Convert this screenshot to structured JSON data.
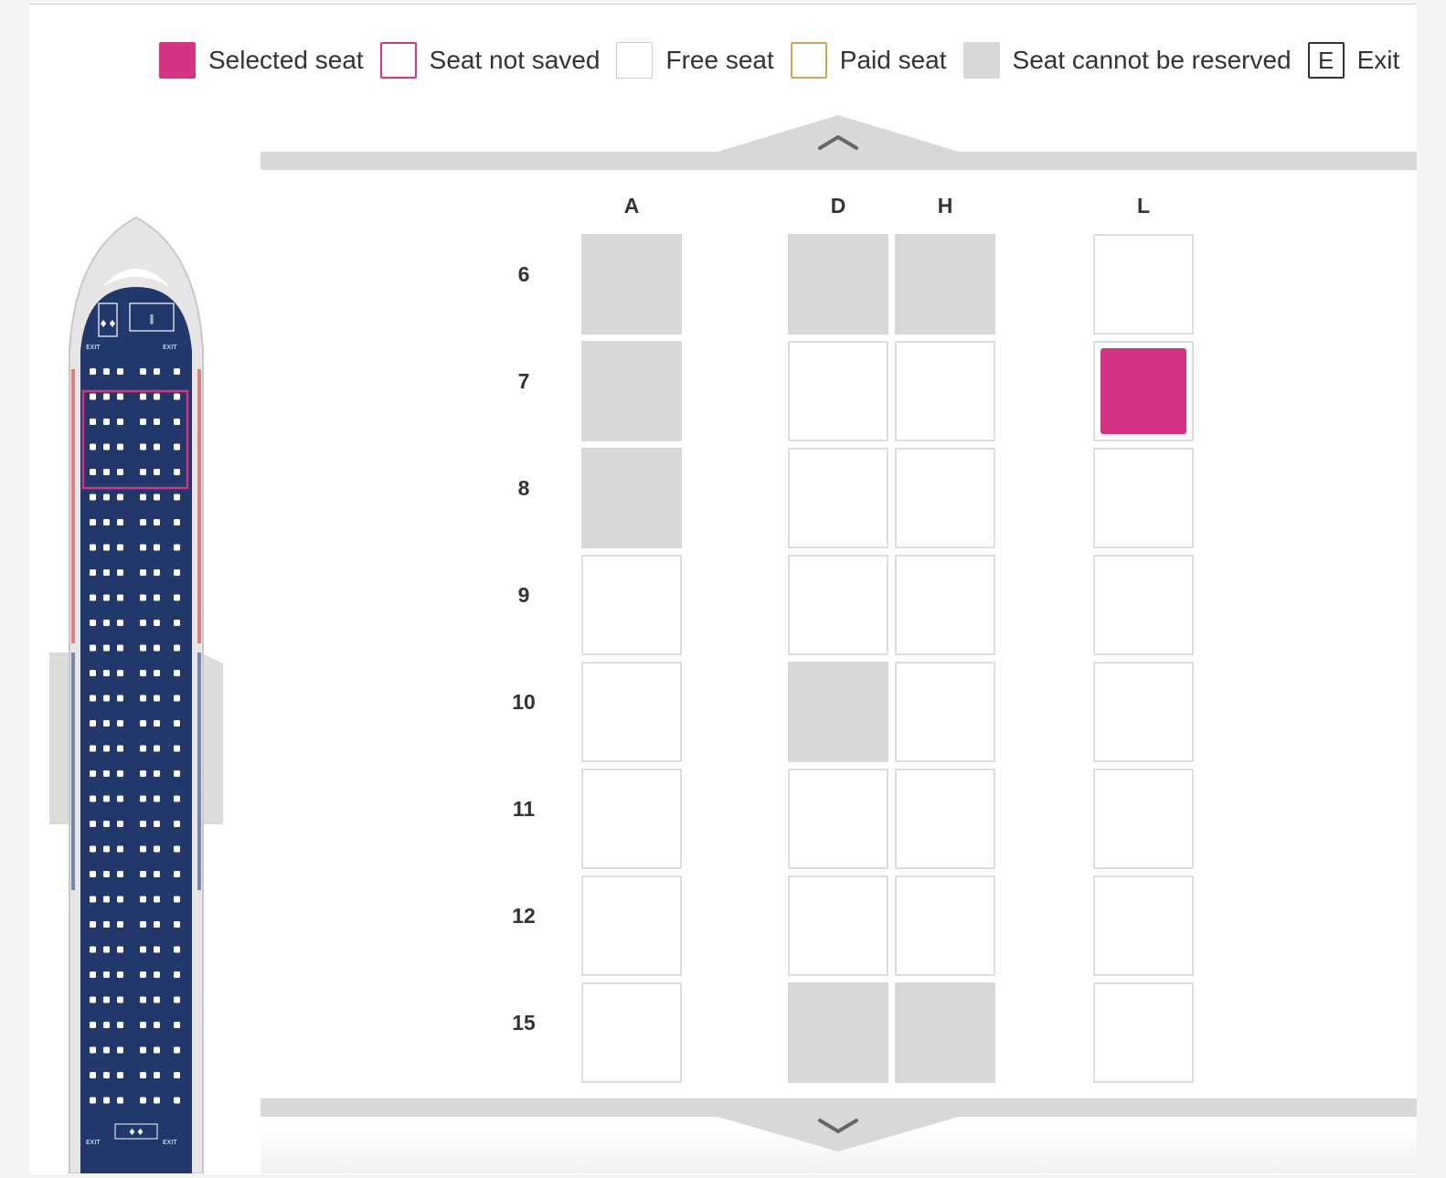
{
  "legend": [
    {
      "key": "selected",
      "label": "Selected seat"
    },
    {
      "key": "notsaved",
      "label": "Seat not saved"
    },
    {
      "key": "free",
      "label": "Free seat"
    },
    {
      "key": "paid",
      "label": "Paid seat"
    },
    {
      "key": "blocked",
      "label": "Seat cannot be reserved"
    },
    {
      "key": "exit",
      "label": "Exit",
      "symbol": "E"
    }
  ],
  "columns": [
    "A",
    "D",
    "H",
    "L"
  ],
  "rows": [
    {
      "number": "6",
      "seats": [
        "blocked",
        "blocked",
        "blocked",
        "free"
      ]
    },
    {
      "number": "7",
      "seats": [
        "blocked",
        "free",
        "free",
        "selected"
      ]
    },
    {
      "number": "8",
      "seats": [
        "blocked",
        "free",
        "free",
        "free"
      ]
    },
    {
      "number": "9",
      "seats": [
        "free",
        "free",
        "free",
        "free"
      ]
    },
    {
      "number": "10",
      "seats": [
        "free",
        "blocked",
        "free",
        "free"
      ]
    },
    {
      "number": "11",
      "seats": [
        "free",
        "free",
        "free",
        "free"
      ]
    },
    {
      "number": "12",
      "seats": [
        "free",
        "free",
        "free",
        "free"
      ]
    },
    {
      "number": "15",
      "seats": [
        "free",
        "blocked",
        "blocked",
        "free"
      ]
    }
  ],
  "minimap": {
    "exit_label": "EXIT"
  },
  "colors": {
    "selected": "#d63384",
    "paid_border": "#c8a858",
    "blocked": "#d8d8d8",
    "cabin": "#22386b"
  },
  "icons": {
    "scroll_up": "chevron-up-icon",
    "scroll_down": "chevron-down-icon"
  }
}
